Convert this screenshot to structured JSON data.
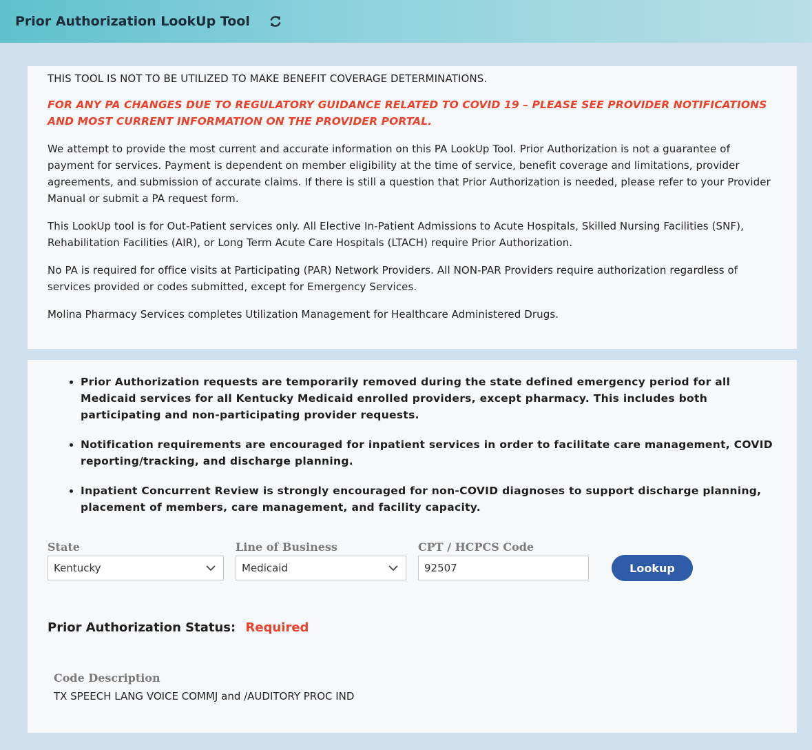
{
  "header": {
    "title": "Prior Authorization LookUp Tool",
    "refresh_icon": "refresh-icon"
  },
  "disclaimer": {
    "caps_notice": "THIS TOOL IS NOT TO BE UTILIZED TO MAKE BENEFIT COVERAGE DETERMINATIONS.",
    "covid_notice": "FOR ANY PA CHANGES DUE TO REGULATORY GUIDANCE RELATED TO COVID 19 – PLEASE SEE PROVIDER NOTIFICATIONS AND MOST CURRENT INFORMATION ON THE PROVIDER PORTAL.",
    "paragraph_1": "We attempt to provide the most current and accurate information on this PA LookUp Tool. Prior Authorization is not a guarantee of payment for services. Payment is dependent on member eligibility at the time of service, benefit coverage and limitations, provider agreements, and submission of accurate claims. If there is still a question that Prior Authorization is needed, please refer to your Provider Manual or submit a PA request form.",
    "paragraph_2": "This LookUp tool is for Out-Patient services only. All Elective In-Patient Admissions to Acute Hospitals, Skilled Nursing Facilities (SNF), Rehabilitation Facilities (AIR), or Long Term Acute Care Hospitals (LTACH) require Prior Authorization.",
    "paragraph_3": "No PA is required for office visits at Participating (PAR) Network Providers. All NON-PAR Providers require authorization regardless of services provided or codes submitted, except for Emergency Services.",
    "paragraph_4": "Molina Pharmacy Services completes Utilization Management for Healthcare Administered Drugs."
  },
  "bullets": [
    "Prior Authorization requests are temporarily removed during the state defined emergency period for all Medicaid services for all Kentucky Medicaid enrolled providers, except pharmacy.  This includes both participating and non-participating provider requests.",
    "Notification requirements are encouraged for inpatient services in order to facilitate care management, COVID reporting/tracking, and discharge planning.",
    "Inpatient Concurrent Review is strongly encouraged for non-COVID diagnoses to support discharge planning, placement of members, care management, and facility capacity."
  ],
  "form": {
    "state": {
      "label": "State",
      "value": "Kentucky"
    },
    "line_of_business": {
      "label": "Line of Business",
      "value": "Medicaid"
    },
    "code": {
      "label": "CPT / HCPCS Code",
      "value": "92507"
    },
    "lookup_label": "Lookup"
  },
  "result": {
    "status_label": "Prior Authorization Status:",
    "status_value": "Required",
    "status_color": "#e8422c",
    "description_label": "Code Description",
    "description_value": "TX SPEECH LANG VOICE COMMJ and /AUDITORY PROC IND"
  },
  "colors": {
    "accent_button": "#2f5ca8",
    "alert_red": "#e8422c",
    "header_teal": "#5fc1cc"
  }
}
